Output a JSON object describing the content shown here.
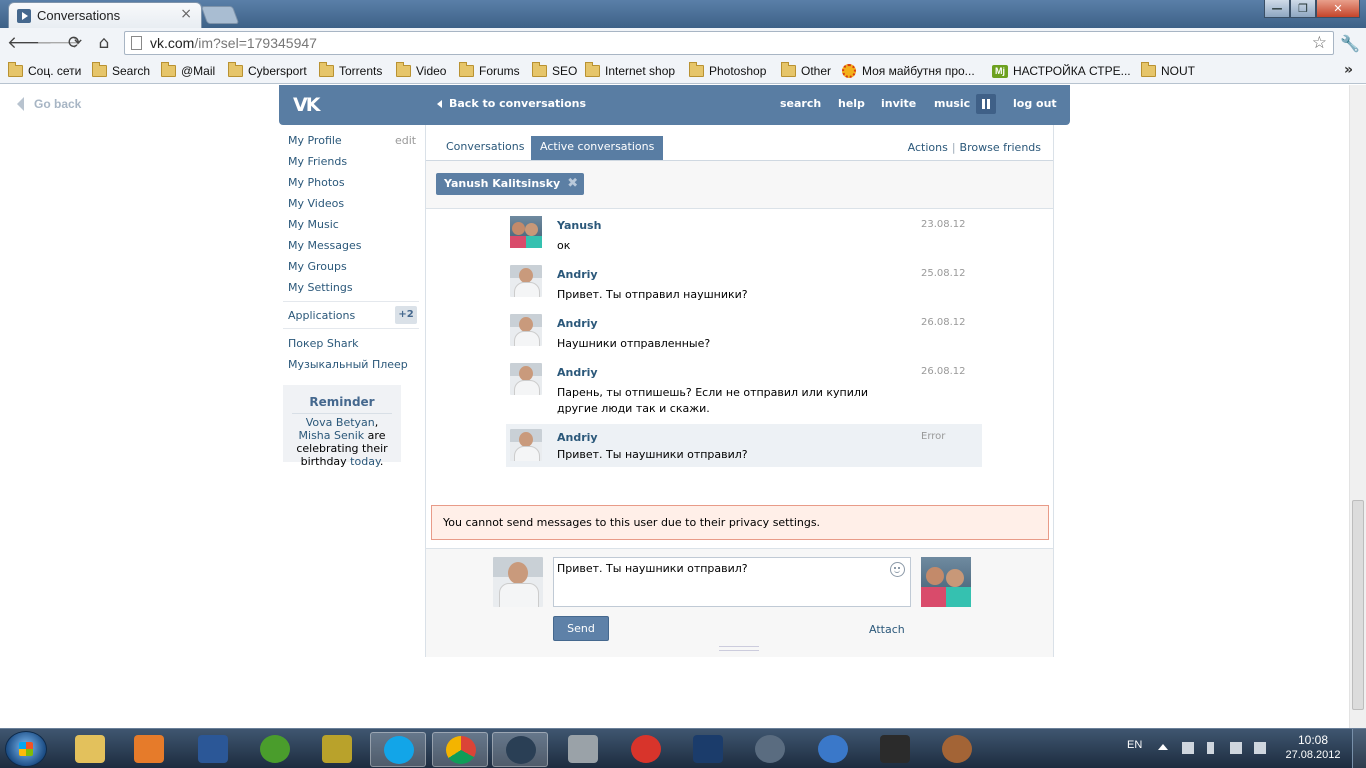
{
  "browser": {
    "tab_title": "Conversations",
    "tab_close": "×",
    "url_host": "vk.com",
    "url_rest": "/im?sel=179345947",
    "nav": {
      "back": "🡐",
      "forward": "🡒",
      "reload": "⟳",
      "home": "⌂",
      "star": "☆",
      "wrench": "🔧"
    },
    "window_buttons": {
      "minimize": "—",
      "maximize": "❐",
      "close": "✕"
    },
    "bookmarks": [
      {
        "label": "Соц. сети",
        "icon": "folder-icon"
      },
      {
        "label": "Search",
        "icon": "folder-icon"
      },
      {
        "label": "@Mail",
        "icon": "folder-icon"
      },
      {
        "label": "Cybersport",
        "icon": "folder-icon"
      },
      {
        "label": "Torrents",
        "icon": "folder-icon"
      },
      {
        "label": "Video",
        "icon": "folder-icon"
      },
      {
        "label": "Forums",
        "icon": "folder-icon"
      },
      {
        "label": "SEO",
        "icon": "folder-icon"
      },
      {
        "label": "Internet shop",
        "icon": "folder-icon"
      },
      {
        "label": "Photoshop",
        "icon": "folder-icon"
      },
      {
        "label": "Other",
        "icon": "folder-icon"
      },
      {
        "label": "Моя майбутня про...",
        "icon": "sun-icon"
      },
      {
        "label": "НАСТРОЙКА СТРЕ...",
        "icon": "mj-icon",
        "icon_text": "Mj"
      },
      {
        "label": "NOUT",
        "icon": "folder-icon"
      }
    ],
    "bookmarks_more": "»"
  },
  "page": {
    "go_back": "Go back",
    "header": {
      "logo": "VK",
      "back_to_conversations": "Back to conversations",
      "links": [
        "search",
        "help",
        "invite",
        "music",
        "log out"
      ]
    },
    "sidebar": {
      "edit": "edit",
      "items": [
        "My Profile",
        "My Friends",
        "My Photos",
        "My Videos",
        "My Music",
        "My Messages",
        "My Groups",
        "My Settings"
      ],
      "applications": "Applications",
      "applications_badge": "+2",
      "apps": [
        "Покер Shark",
        "Музыкальный Плеер"
      ],
      "reminder": {
        "title": "Reminder",
        "name1": "Vova Betyan",
        "comma": ", ",
        "name2": "Misha Senik",
        "mid": " are celebrating their birthday ",
        "today": "today",
        "end": "."
      }
    },
    "tabs": [
      "Conversations",
      "Active conversations"
    ],
    "actions": "Actions",
    "actions_sep": "|",
    "browse_friends": "Browse friends",
    "peer": "Yanush Kalitsinsky",
    "peer_remove": "✖",
    "messages": [
      {
        "author": "Yanush",
        "date": "23.08.12",
        "text": "ок",
        "avatar": "yanush"
      },
      {
        "author": "Andriy",
        "date": "25.08.12",
        "text": "Привет. Ты отправил наушники?",
        "avatar": "andriy"
      },
      {
        "author": "Andriy",
        "date": "26.08.12",
        "text": "Наушники отправленные?",
        "avatar": "andriy"
      },
      {
        "author": "Andriy",
        "date": "26.08.12",
        "text": "Парень, ты отпишешь? Если не отправил или купили другие люди так и скажи.",
        "avatar": "andriy"
      },
      {
        "author": "Andriy",
        "date": "Error",
        "text": "Привет. Ты наушники отправил?",
        "avatar": "andriy"
      }
    ],
    "privacy_notice": "You cannot send messages to this user due to their privacy settings.",
    "composer": {
      "value": "Привет. Ты наушники отправил?",
      "send": "Send",
      "attach": "Attach"
    }
  },
  "taskbar": {
    "apps": [
      "explorer",
      "media-player",
      "word",
      "utorrent",
      "game",
      "skype",
      "chrome",
      "steam",
      "game-launcher",
      "opera-mini",
      "photoshop",
      "teamspeak",
      "ccleaner",
      "terminal",
      "teddy-bear"
    ],
    "active_app": "chrome",
    "language": "EN",
    "time": "10:08",
    "date": "27.08.2012"
  },
  "colors": {
    "vk_blue": "#597da3",
    "link": "#2b587a",
    "error_bg": "#ffefe8",
    "error_border": "#e89b88"
  }
}
